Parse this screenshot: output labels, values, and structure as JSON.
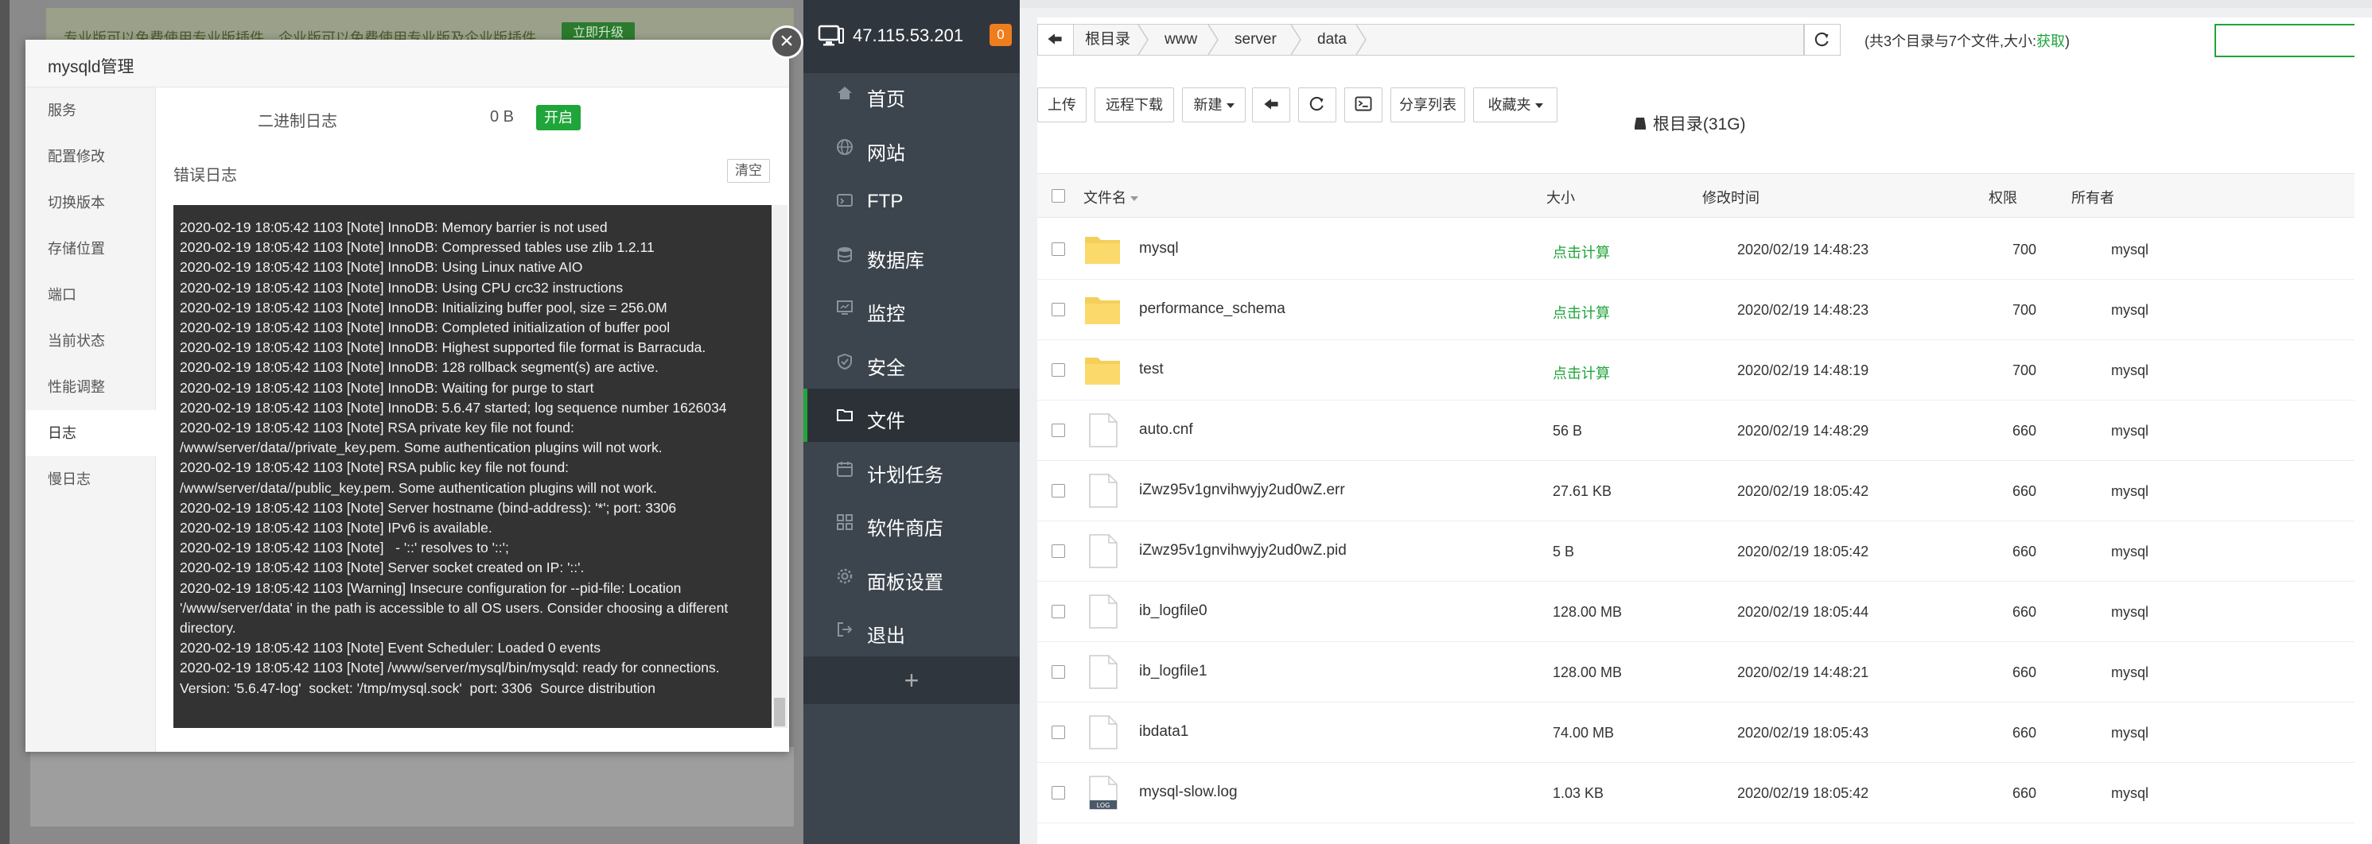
{
  "background": {
    "banner_text": "专业版可以免费使用专业版插件，企业版可以免费使用专业版及企业版插件",
    "banner_button": "立即升级"
  },
  "modal": {
    "title": "mysqld管理",
    "close_label": "×",
    "menu": [
      "服务",
      "配置修改",
      "切换版本",
      "存储位置",
      "端口",
      "当前状态",
      "性能调整",
      "日志",
      "慢日志"
    ],
    "active_menu": "日志",
    "binlog_label": "二进制日志",
    "binlog_size": "0 B",
    "binlog_button": "开启",
    "errlog_label": "错误日志",
    "clear_button": "清空",
    "log_lines": [
      "2020-02-19 18:05:42 1103 [Note] InnoDB: Memory barrier is not used",
      "2020-02-19 18:05:42 1103 [Note] InnoDB: Compressed tables use zlib 1.2.11",
      "2020-02-19 18:05:42 1103 [Note] InnoDB: Using Linux native AIO",
      "2020-02-19 18:05:42 1103 [Note] InnoDB: Using CPU crc32 instructions",
      "2020-02-19 18:05:42 1103 [Note] InnoDB: Initializing buffer pool, size = 256.0M",
      "2020-02-19 18:05:42 1103 [Note] InnoDB: Completed initialization of buffer pool",
      "2020-02-19 18:05:42 1103 [Note] InnoDB: Highest supported file format is Barracuda.",
      "2020-02-19 18:05:42 1103 [Note] InnoDB: 128 rollback segment(s) are active.",
      "2020-02-19 18:05:42 1103 [Note] InnoDB: Waiting for purge to start",
      "2020-02-19 18:05:42 1103 [Note] InnoDB: 5.6.47 started; log sequence number 1626034",
      "2020-02-19 18:05:42 1103 [Note] RSA private key file not found: /www/server/data//private_key.pem. Some authentication plugins will not work.",
      "2020-02-19 18:05:42 1103 [Note] RSA public key file not found: /www/server/data//public_key.pem. Some authentication plugins will not work.",
      "2020-02-19 18:05:42 1103 [Note] Server hostname (bind-address): '*'; port: 3306",
      "2020-02-19 18:05:42 1103 [Note] IPv6 is available.",
      "2020-02-19 18:05:42 1103 [Note]   - '::' resolves to '::';",
      "2020-02-19 18:05:42 1103 [Note] Server socket created on IP: '::'.",
      "2020-02-19 18:05:42 1103 [Warning] Insecure configuration for --pid-file: Location '/www/server/data' in the path is accessible to all OS users. Consider choosing a different directory.",
      "2020-02-19 18:05:42 1103 [Note] Event Scheduler: Loaded 0 events",
      "2020-02-19 18:05:42 1103 [Note] /www/server/mysql/bin/mysqld: ready for connections.",
      "Version: '5.6.47-log'  socket: '/tmp/mysql.sock'  port: 3306  Source distribution"
    ]
  },
  "sidebar": {
    "ip": "47.115.53.201",
    "badge": "0",
    "items": [
      {
        "label": "首页",
        "icon": "home-icon"
      },
      {
        "label": "网站",
        "icon": "globe-icon"
      },
      {
        "label": "FTP",
        "icon": "ftp-icon"
      },
      {
        "label": "数据库",
        "icon": "database-icon"
      },
      {
        "label": "监控",
        "icon": "monitor-icon"
      },
      {
        "label": "安全",
        "icon": "shield-icon"
      },
      {
        "label": "文件",
        "icon": "folder-icon"
      },
      {
        "label": "计划任务",
        "icon": "calendar-icon"
      },
      {
        "label": "软件商店",
        "icon": "apps-icon"
      },
      {
        "label": "面板设置",
        "icon": "gear-icon"
      },
      {
        "label": "退出",
        "icon": "logout-icon"
      }
    ],
    "active_item": "文件",
    "add_label": "+"
  },
  "files": {
    "breadcrumbs": [
      "根目录",
      "www",
      "server",
      "data"
    ],
    "info_text": "(共3个目录与7个文件,大小:",
    "info_link": "获取",
    "info_close": ")",
    "toolbar": {
      "upload": "上传",
      "remote_download": "远程下载",
      "new": "新建",
      "share_list": "分享列表",
      "favorites": "收藏夹",
      "disk": "根目录(31G)"
    },
    "columns": {
      "name": "文件名",
      "size": "大小",
      "mtime": "修改时间",
      "perm": "权限",
      "owner": "所有者"
    },
    "rows": [
      {
        "name": "mysql",
        "type": "folder",
        "size": "点击计算",
        "mtime": "2020/02/19 14:48:23",
        "perm": "700",
        "owner": "mysql"
      },
      {
        "name": "performance_schema",
        "type": "folder",
        "size": "点击计算",
        "mtime": "2020/02/19 14:48:23",
        "perm": "700",
        "owner": "mysql"
      },
      {
        "name": "test",
        "type": "folder",
        "size": "点击计算",
        "mtime": "2020/02/19 14:48:19",
        "perm": "700",
        "owner": "mysql"
      },
      {
        "name": "auto.cnf",
        "type": "file",
        "size": "56 B",
        "mtime": "2020/02/19 14:48:29",
        "perm": "660",
        "owner": "mysql"
      },
      {
        "name": "iZwz95v1gnvihwyjy2ud0wZ.err",
        "type": "file",
        "size": "27.61 KB",
        "mtime": "2020/02/19 18:05:42",
        "perm": "660",
        "owner": "mysql"
      },
      {
        "name": "iZwz95v1gnvihwyjy2ud0wZ.pid",
        "type": "file",
        "size": "5 B",
        "mtime": "2020/02/19 18:05:42",
        "perm": "660",
        "owner": "mysql"
      },
      {
        "name": "ib_logfile0",
        "type": "file",
        "size": "128.00 MB",
        "mtime": "2020/02/19 18:05:44",
        "perm": "660",
        "owner": "mysql"
      },
      {
        "name": "ib_logfile1",
        "type": "file",
        "size": "128.00 MB",
        "mtime": "2020/02/19 14:48:21",
        "perm": "660",
        "owner": "mysql"
      },
      {
        "name": "ibdata1",
        "type": "file",
        "size": "74.00 MB",
        "mtime": "2020/02/19 18:05:43",
        "perm": "660",
        "owner": "mysql"
      },
      {
        "name": "mysql-slow.log",
        "type": "log",
        "size": "1.03 KB",
        "mtime": "2020/02/19 18:05:42",
        "perm": "660",
        "owner": "mysql"
      }
    ]
  }
}
